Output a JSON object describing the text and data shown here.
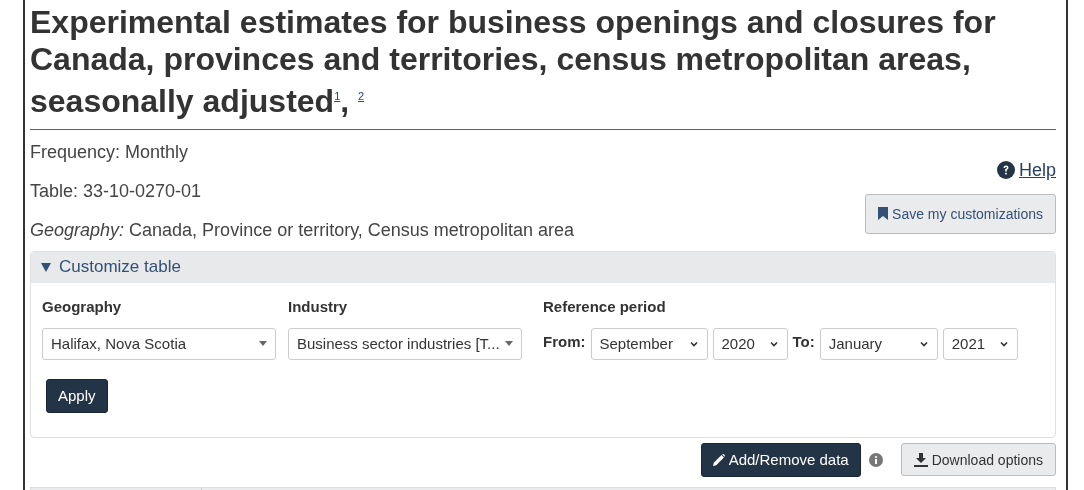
{
  "title": "Experimental estimates for business openings and closures for Canada, provinces and territories, census metropolitan areas, seasonally adjusted$^{1}$, $^{2}$",
  "info": [
    "Frequency: Monthly",
    "Table: 33-10-0270-01",
    "*Geography:* Canada, Province or territory, Census metropolitan area"
  ],
  "help_link": "Help",
  "save_button": "Save my customizations",
  "customize": {
    "heading": "Customize table",
    "expanded": true,
    "geography": {
      "label": "Geography",
      "value": "Halifax, Nova Scotia"
    },
    "industry": {
      "label": "Industry",
      "value": "Business sector industries [T..."
    },
    "reference_period": {
      "label": "Reference period",
      "from_label": "From:",
      "from_month": "September",
      "from_year": "2020",
      "to_label": "To:",
      "to_month": "January",
      "to_year": "2021"
    },
    "apply": "Apply"
  },
  "actions": {
    "add_remove": "Add/Remove data",
    "download": "Download options"
  }
}
